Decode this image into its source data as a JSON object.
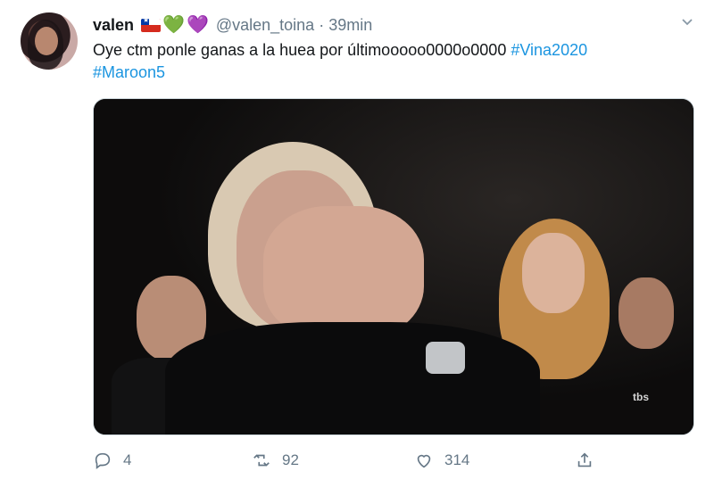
{
  "tweet": {
    "name": "valen",
    "handle": "@valen_toina",
    "separator": "·",
    "time": "39min",
    "emoji_hearts": [
      "💚",
      "💜"
    ],
    "text_main": "Oye ctm ponle ganas a la huea por últimooooo0000o0000 ",
    "hashtag_1": "#Vina2020",
    "hashtag_2": "#Maroon5",
    "media_logo": "tbs",
    "actions": {
      "reply_count": "4",
      "retweet_count": "92",
      "like_count": "314"
    }
  },
  "colors": {
    "link": "#1b95e0",
    "secondary_text": "#657786",
    "flag_red": "#d52b1e",
    "flag_blue": "#0039a6"
  },
  "icons": {
    "reply": "reply-icon",
    "retweet": "retweet-icon",
    "like": "heart-icon",
    "share": "share-icon",
    "more": "chevron-down-icon"
  }
}
